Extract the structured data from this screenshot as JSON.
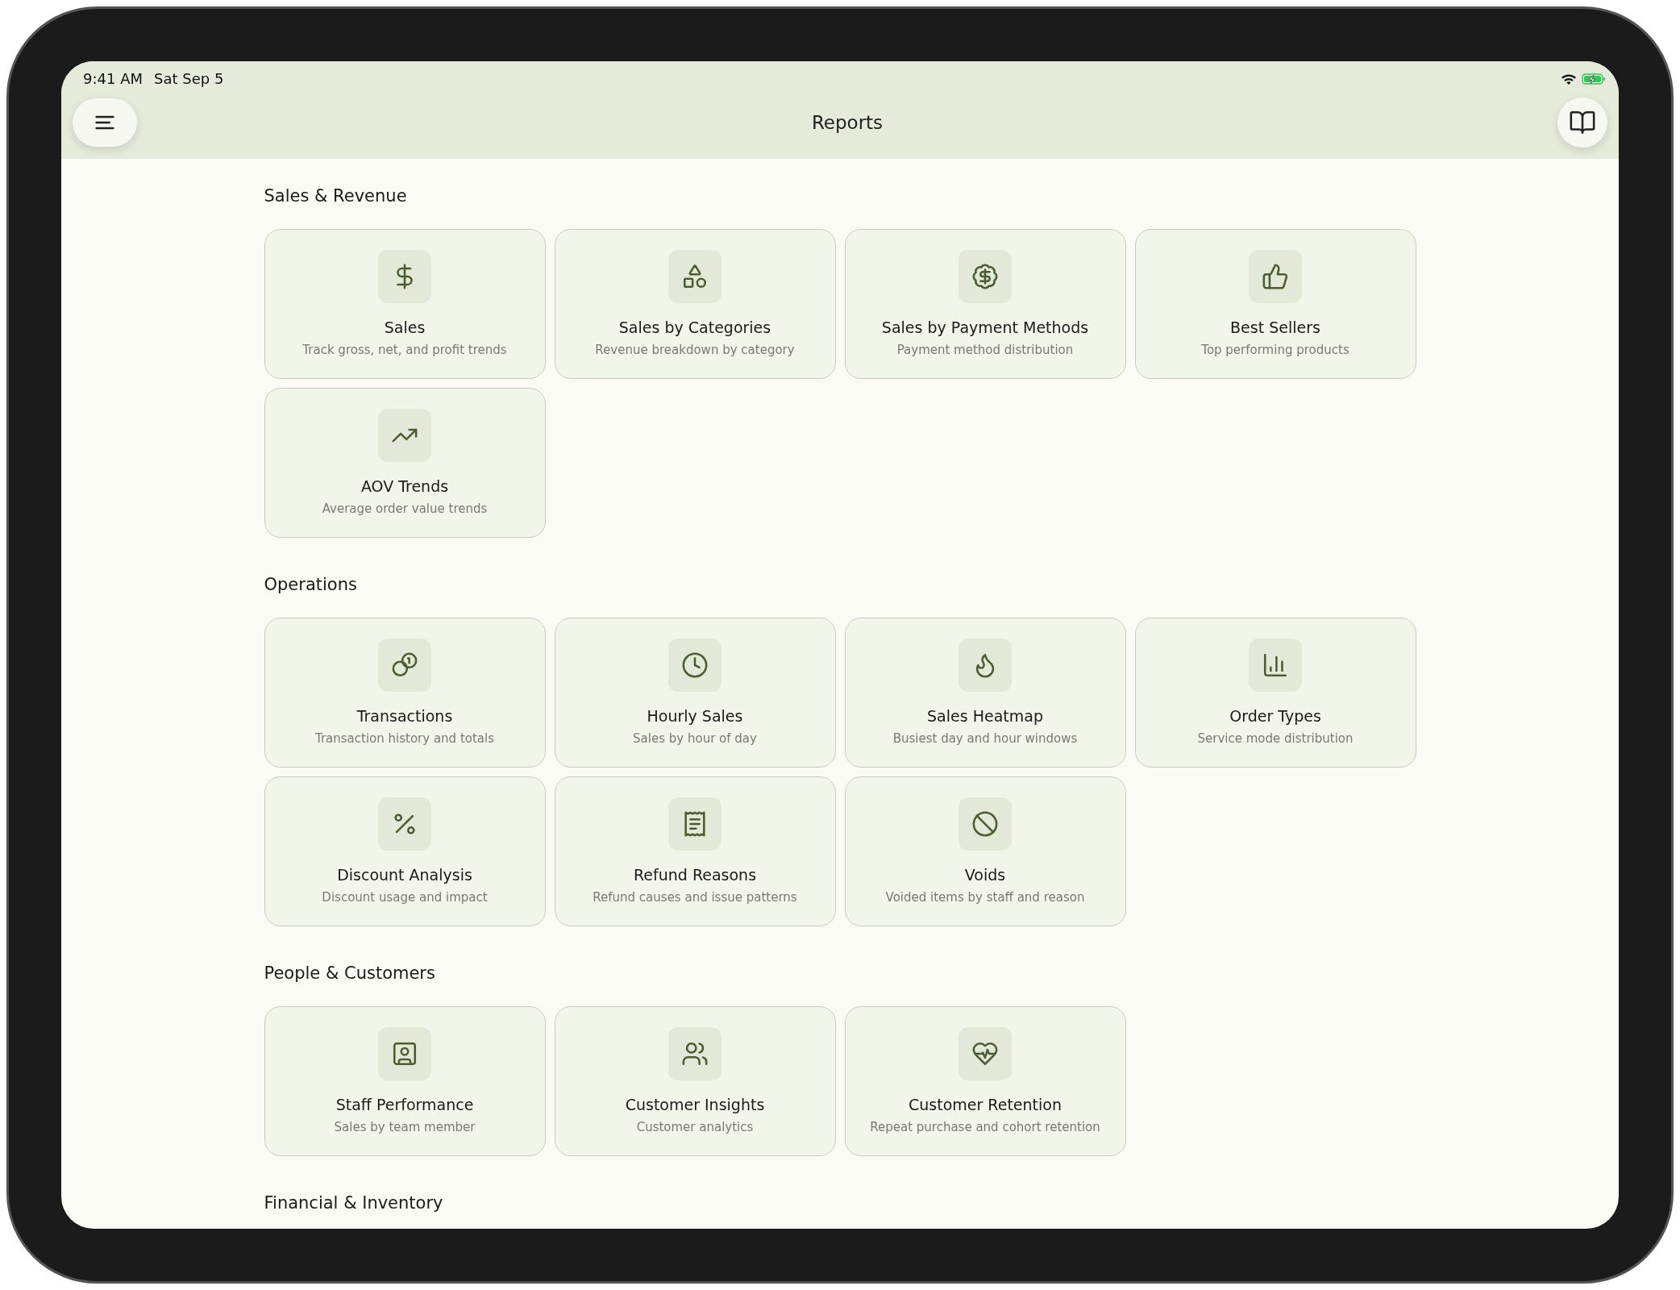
{
  "status_bar": {
    "time": "9:41 AM",
    "date": "Sat Sep 5",
    "battery_charging": true
  },
  "header": {
    "title": "Reports"
  },
  "sections": [
    {
      "title": "Sales & Revenue",
      "cards": [
        {
          "title": "Sales",
          "subtitle": "Track gross, net, and profit trends"
        },
        {
          "title": "Sales by Categories",
          "subtitle": "Revenue breakdown by category"
        },
        {
          "title": "Sales by Payment Methods",
          "subtitle": "Payment method distribution"
        },
        {
          "title": "Best Sellers",
          "subtitle": "Top performing products"
        },
        {
          "title": "AOV Trends",
          "subtitle": "Average order value trends"
        }
      ]
    },
    {
      "title": "Operations",
      "cards": [
        {
          "title": "Transactions",
          "subtitle": "Transaction history and totals"
        },
        {
          "title": "Hourly Sales",
          "subtitle": "Sales by hour of day"
        },
        {
          "title": "Sales Heatmap",
          "subtitle": "Busiest day and hour windows"
        },
        {
          "title": "Order Types",
          "subtitle": "Service mode distribution"
        },
        {
          "title": "Discount Analysis",
          "subtitle": "Discount usage and impact"
        },
        {
          "title": "Refund Reasons",
          "subtitle": "Refund causes and issue patterns"
        },
        {
          "title": "Voids",
          "subtitle": "Voided items by staff and reason"
        }
      ]
    },
    {
      "title": "People & Customers",
      "cards": [
        {
          "title": "Staff Performance",
          "subtitle": "Sales by team member"
        },
        {
          "title": "Customer Insights",
          "subtitle": "Customer analytics"
        },
        {
          "title": "Customer Retention",
          "subtitle": "Repeat purchase and cohort retention"
        }
      ]
    },
    {
      "title": "Financial & Inventory"
    }
  ]
}
